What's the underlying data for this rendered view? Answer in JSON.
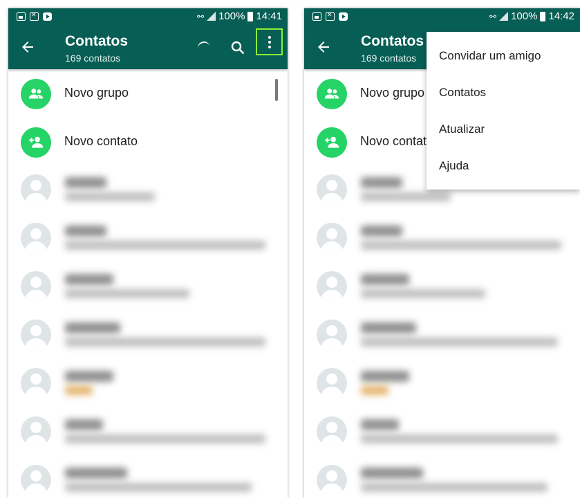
{
  "colors": {
    "appbar": "#075e54",
    "accent": "#25d366",
    "highlight": "#8cef33",
    "avatar_placeholder": "#dfe5e7"
  },
  "left_screen": {
    "status": {
      "battery": "100%",
      "time": "14:41"
    },
    "header": {
      "title": "Contatos",
      "subtitle": "169 contatos"
    },
    "actions": [
      {
        "label": "Novo grupo",
        "icon": "group-icon"
      },
      {
        "label": "Novo contato",
        "icon": "add-contact-icon"
      }
    ]
  },
  "right_screen": {
    "status": {
      "battery": "100%",
      "time": "14:42"
    },
    "header": {
      "title": "Contatos",
      "subtitle": "169 contatos"
    },
    "actions": [
      {
        "label": "Novo grupo",
        "icon": "group-icon"
      },
      {
        "label": "Novo contat",
        "icon": "add-contact-icon"
      }
    ],
    "menu": [
      {
        "label": "Convidar um amigo"
      },
      {
        "label": "Contatos"
      },
      {
        "label": "Atualizar"
      },
      {
        "label": "Ajuda"
      }
    ]
  },
  "icons": {
    "back": "arrow-left-icon",
    "search": "search-icon",
    "more": "more-vert-icon",
    "refresh": "refresh-spinner-icon"
  }
}
